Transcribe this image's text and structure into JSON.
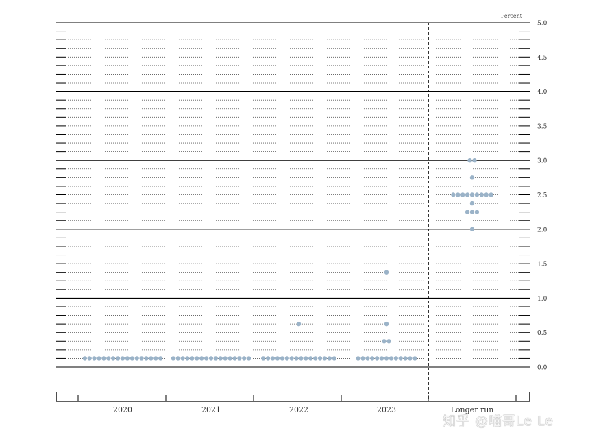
{
  "chart_data": {
    "type": "scatter",
    "unit_label": "Percent",
    "categories": [
      "2020",
      "2021",
      "2022",
      "2023",
      "Longer run"
    ],
    "ylim": [
      0,
      5
    ],
    "yticks": [
      "0.0",
      "0.5",
      "1.0",
      "1.5",
      "2.0",
      "2.5",
      "3.0",
      "3.5",
      "4.0",
      "4.5",
      "5.0"
    ],
    "grid": true,
    "points": [
      {
        "category": "2020",
        "value": 0.125,
        "count": 17
      },
      {
        "category": "2021",
        "value": 0.125,
        "count": 17
      },
      {
        "category": "2022",
        "value": 0.125,
        "count": 16
      },
      {
        "category": "2022",
        "value": 0.625,
        "count": 1
      },
      {
        "category": "2023",
        "value": 0.125,
        "count": 13
      },
      {
        "category": "2023",
        "value": 0.375,
        "count": 2
      },
      {
        "category": "2023",
        "value": 0.625,
        "count": 1
      },
      {
        "category": "2023",
        "value": 1.375,
        "count": 1
      },
      {
        "category": "Longer run",
        "value": 2.0,
        "count": 1
      },
      {
        "category": "Longer run",
        "value": 2.25,
        "count": 3
      },
      {
        "category": "Longer run",
        "value": 2.375,
        "count": 1
      },
      {
        "category": "Longer run",
        "value": 2.5,
        "count": 9
      },
      {
        "category": "Longer run",
        "value": 2.75,
        "count": 1
      },
      {
        "category": "Longer run",
        "value": 3.0,
        "count": 2
      }
    ],
    "dot_color": "#9bb3c8"
  },
  "watermark": "知乎 @喵哥Le Le"
}
